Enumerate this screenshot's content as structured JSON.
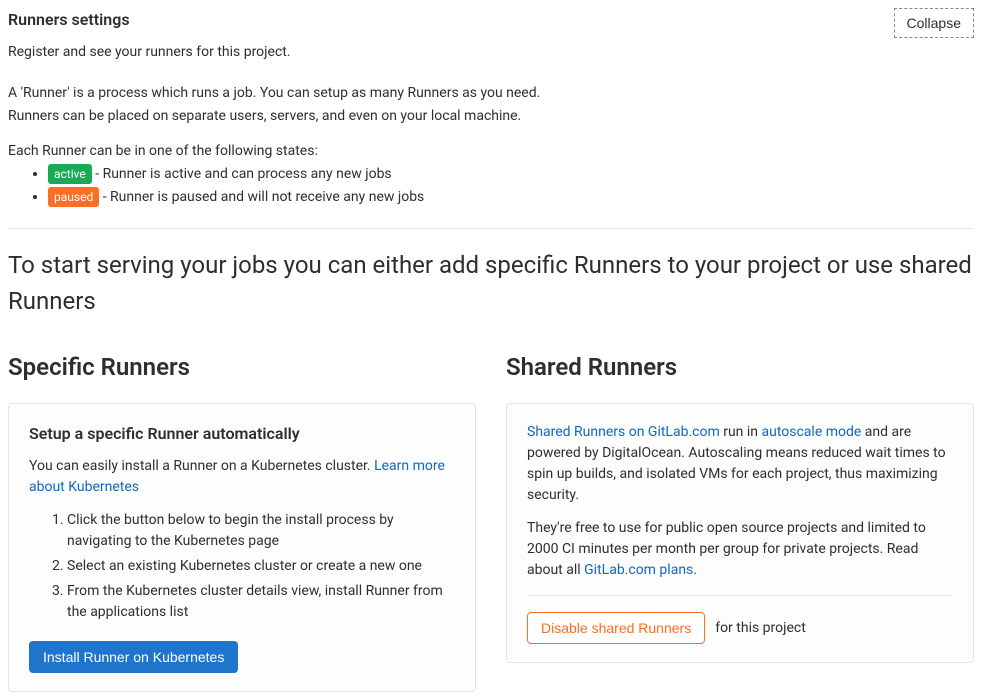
{
  "header": {
    "title": "Runners settings",
    "collapse_label": "Collapse",
    "subtitle": "Register and see your runners for this project."
  },
  "intro": {
    "line1": "A 'Runner' is a process which runs a job. You can setup as many Runners as you need.",
    "line2": "Runners can be placed on separate users, servers, and even on your local machine.",
    "states_intro": "Each Runner can be in one of the following states:",
    "state_active_badge": "active",
    "state_active_desc": " - Runner is active and can process any new jobs",
    "state_paused_badge": "paused",
    "state_paused_desc": " - Runner is paused and will not receive any new jobs"
  },
  "start_heading": "To start serving your jobs you can either add specific Runners to your project or use shared Runners",
  "specific": {
    "heading": "Specific Runners",
    "card_title": "Setup a specific Runner automatically",
    "card_intro": "You can easily install a Runner on a Kubernetes cluster. ",
    "learn_link": "Learn more about Kubernetes",
    "steps": [
      "Click the button below to begin the install process by navigating to the Kubernetes page",
      "Select an existing Kubernetes cluster or create a new one",
      "From the Kubernetes cluster details view, install Runner from the applications list"
    ],
    "install_btn": "Install Runner on Kubernetes"
  },
  "shared": {
    "heading": "Shared Runners",
    "p1_link1": "Shared Runners on GitLab.com",
    "p1_mid1": " run in ",
    "p1_link2": "autoscale mode",
    "p1_tail": " and are powered by DigitalOcean. Autoscaling means reduced wait times to spin up builds, and isolated VMs for each project, thus maximizing security.",
    "p2_pre": "They're free to use for public open source projects and limited to 2000 CI minutes per month per group for private projects. Read about all ",
    "p2_link": "GitLab.com plans",
    "p2_post": ".",
    "disable_btn": "Disable shared Runners",
    "disable_suffix": "for this project"
  }
}
